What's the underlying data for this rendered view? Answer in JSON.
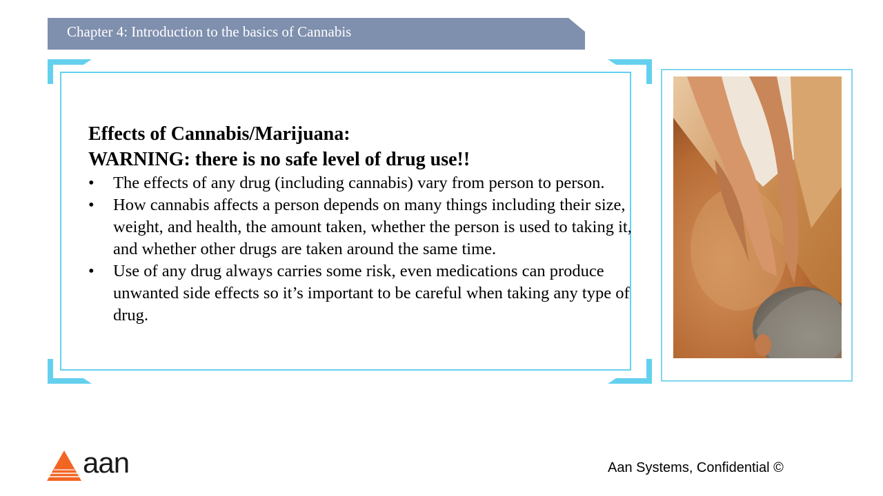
{
  "banner": {
    "chapter_title": "Chapter 4: Introduction to the basics of Cannabis"
  },
  "content": {
    "heading_line1": "Effects of Cannabis/Marijuana:",
    "heading_line2": "WARNING: there is no safe level of drug use!!",
    "bullet_glyph": "•",
    "bullets": [
      "The effects of any drug (including cannabis) vary from person to person.",
      "How cannabis affects a person depends on many things including their size, weight, and health, the amount taken, whether the person is used to taking it, and whether other drugs are taken around the same time.",
      "Use of any drug always carries some risk, even medications can produce unwanted side effects so it’s important to be careful when taking any type of drug."
    ]
  },
  "image": {
    "icon": "massage-photo"
  },
  "footer": {
    "logo_text": "aan",
    "confidential": "Aan Systems, Confidential ©"
  },
  "colors": {
    "banner": "#7f8fae",
    "frame_accent": "#64d0ee",
    "logo_orange": "#f26522"
  }
}
